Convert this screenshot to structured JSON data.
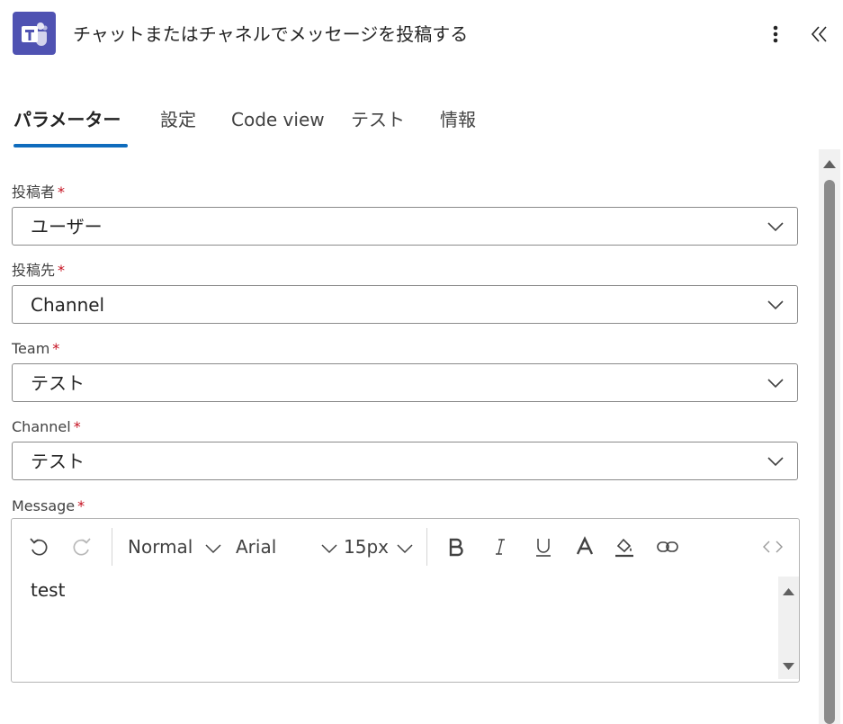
{
  "header": {
    "title": "チャットまたはチャネルでメッセージを投稿する",
    "app_icon": "teams-icon",
    "more_icon": "more-vertical-icon",
    "collapse_icon": "double-chevron-left-icon"
  },
  "tabs": [
    {
      "label": "パラメーター",
      "active": true
    },
    {
      "label": "設定",
      "active": false
    },
    {
      "label": "Code view",
      "active": false
    },
    {
      "label": "テスト",
      "active": false
    },
    {
      "label": "情報",
      "active": false
    }
  ],
  "fields": {
    "post_as": {
      "label": "投稿者",
      "required": "*",
      "value": "ユーザー"
    },
    "post_in": {
      "label": "投稿先",
      "required": "*",
      "value": "Channel"
    },
    "team": {
      "label": "Team",
      "required": "*",
      "value": "テスト"
    },
    "channel": {
      "label": "Channel",
      "required": "*",
      "value": "テスト"
    },
    "message": {
      "label": "Message",
      "required": "*",
      "value": "test",
      "toolbar": {
        "paragraph_style": "Normal",
        "font": "Arial",
        "font_size": "15px"
      }
    }
  },
  "colors": {
    "accent": "#0f6cbd",
    "required": "#c50f1f",
    "teams_brand": "#4f52b2"
  }
}
